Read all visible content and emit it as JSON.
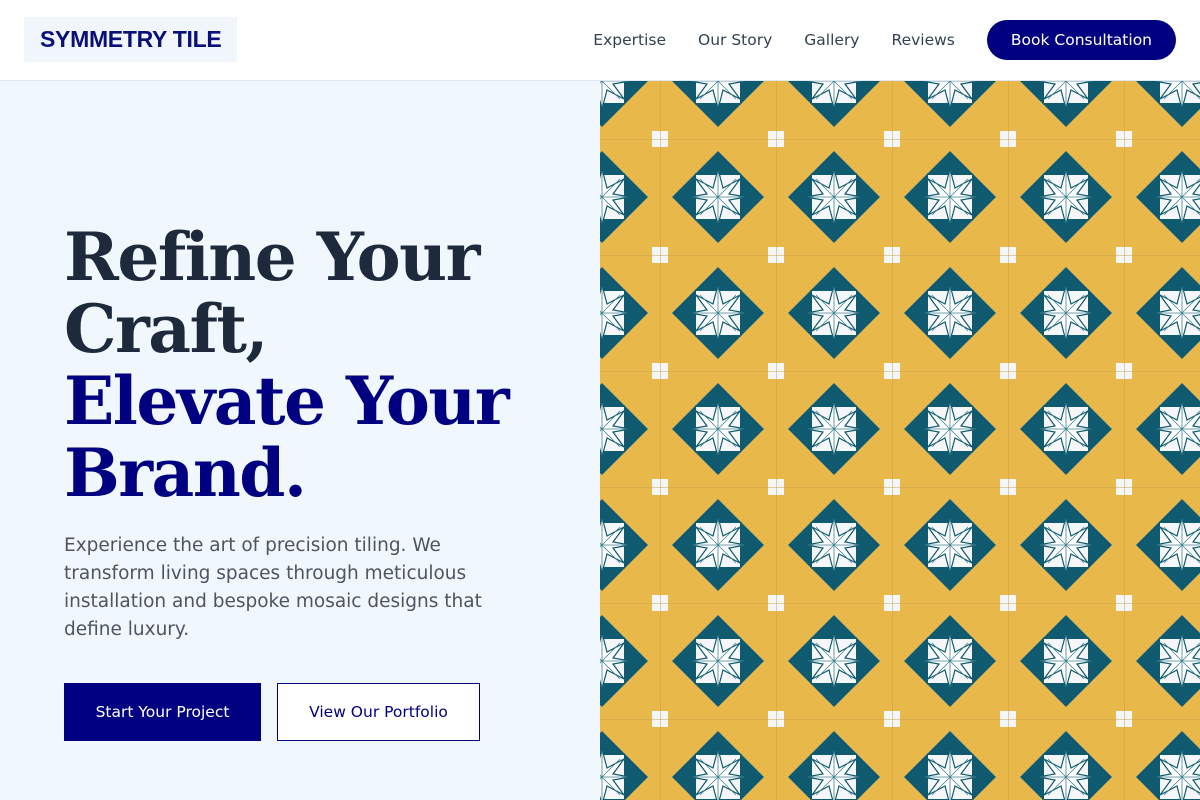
{
  "brand": {
    "name": "SYMMETRY TILE"
  },
  "nav": {
    "links": [
      "Expertise",
      "Our Story",
      "Gallery",
      "Reviews"
    ],
    "cta_label": "Book Consultation"
  },
  "hero": {
    "headline_line1": "Refine Your",
    "headline_line2": "Craft,",
    "headline_accent_line1": "Elevate Your",
    "headline_accent_line2": "Brand.",
    "description": "Experience the art of precision tiling. We transform living spaces through meticulous installation and bespoke mosaic designs that define luxury.",
    "primary_button": "Start Your Project",
    "secondary_button": "View Our Portfolio"
  },
  "image": {
    "subject": "mosaic-tile-pattern",
    "colors": {
      "yellow": "#e9b84a",
      "teal": "#0f5a6e",
      "white": "#f4f6f7"
    }
  },
  "colors": {
    "brand": "#000080",
    "heading": "#1e293b",
    "text": "#4b5563",
    "hero_bg": "#f0f7fd"
  }
}
